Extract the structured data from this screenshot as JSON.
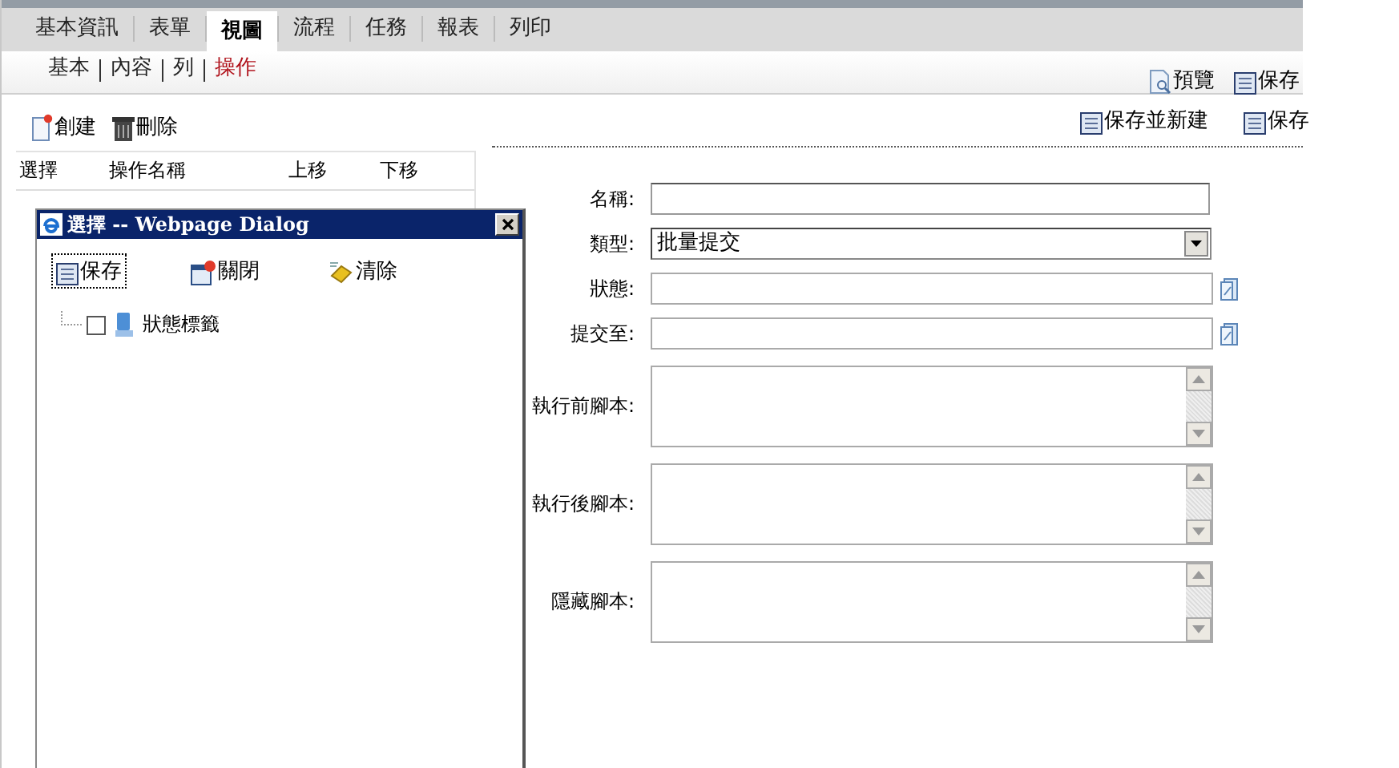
{
  "top_tabs": [
    {
      "label": "基本資訊",
      "selected": false
    },
    {
      "label": "表單",
      "selected": false
    },
    {
      "label": "視圖",
      "selected": true
    },
    {
      "label": "流程",
      "selected": false
    },
    {
      "label": "任務",
      "selected": false
    },
    {
      "label": "報表",
      "selected": false
    },
    {
      "label": "列印",
      "selected": false
    }
  ],
  "sub_tabs": [
    {
      "label": "基本",
      "selected": false
    },
    {
      "label": "內容",
      "selected": false
    },
    {
      "label": "列",
      "selected": false
    },
    {
      "label": "操作",
      "selected": true
    }
  ],
  "header_actions": [
    {
      "label": "預覽",
      "kind": "preview"
    },
    {
      "label": "保存",
      "kind": "save"
    }
  ],
  "toolbar": {
    "left": [
      {
        "label": "創建",
        "kind": "new"
      },
      {
        "label": "刪除",
        "kind": "delete"
      }
    ],
    "right": [
      {
        "label": "保存並新建",
        "kind": "save"
      },
      {
        "label": "保存",
        "kind": "save"
      }
    ]
  },
  "list": {
    "columns": [
      "選擇",
      "操作名稱",
      "上移",
      "下移"
    ]
  },
  "form": {
    "fields": [
      {
        "label": "名稱:",
        "kind": "text"
      },
      {
        "label": "類型:",
        "kind": "select",
        "value": "批量提交"
      },
      {
        "label": "狀態:",
        "kind": "picker"
      },
      {
        "label": "提交至:",
        "kind": "picker"
      },
      {
        "label": "執行前腳本:",
        "kind": "textarea"
      },
      {
        "label": "執行後腳本:",
        "kind": "textarea"
      },
      {
        "label": "隱藏腳本:",
        "kind": "textarea"
      }
    ]
  },
  "dialog": {
    "title": "選擇 -- Webpage Dialog",
    "actions": [
      {
        "label": "保存",
        "kind": "save",
        "focused": true
      },
      {
        "label": "關閉",
        "kind": "close",
        "focused": false
      },
      {
        "label": "清除",
        "kind": "clear",
        "focused": false
      }
    ],
    "tree": [
      {
        "label": "狀態標籤",
        "checked": false
      }
    ]
  }
}
